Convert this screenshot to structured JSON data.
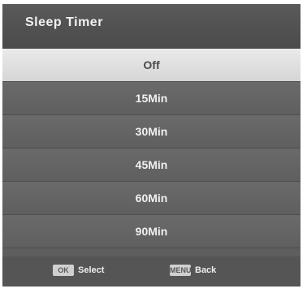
{
  "title": "Sleep Timer",
  "options": [
    "Off",
    "15Min",
    "30Min",
    "45Min",
    "60Min",
    "90Min"
  ],
  "selected": "Off",
  "footer": {
    "select_key": "OK",
    "select_label": "Select",
    "back_key": "MENU",
    "back_label": "Back"
  },
  "colors": {
    "panel": "#5e5e5e",
    "highlight": "#e0e0e0",
    "text": "#f0f0f0"
  }
}
